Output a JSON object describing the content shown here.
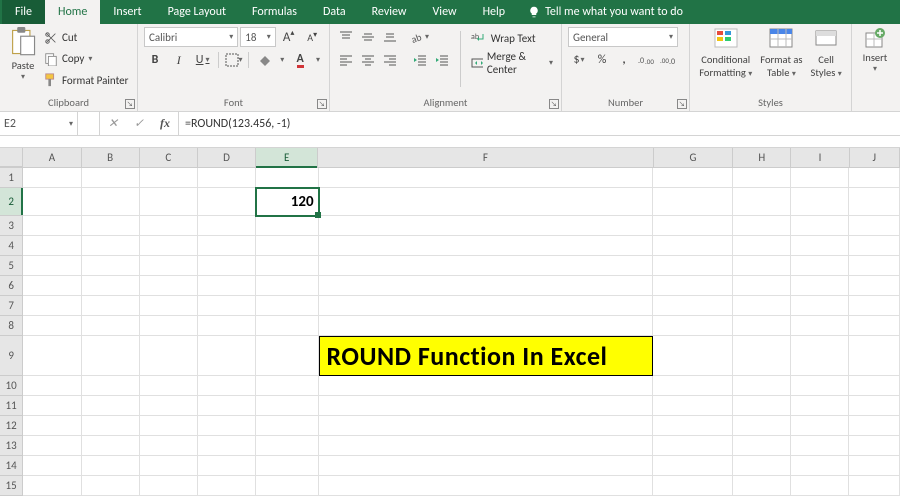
{
  "tabs": {
    "file": "File",
    "home": "Home",
    "insert": "Insert",
    "pageLayout": "Page Layout",
    "formulas": "Formulas",
    "data": "Data",
    "review": "Review",
    "view": "View",
    "help": "Help",
    "tell": "Tell me what you want to do"
  },
  "clipboard": {
    "paste": "Paste",
    "cut": "Cut",
    "copy": "Copy",
    "fmtPainter": "Format Painter",
    "label": "Clipboard"
  },
  "font": {
    "name": "Calibri",
    "size": "18",
    "incA": "A",
    "decA": "A",
    "bold": "B",
    "italic": "I",
    "underline": "U",
    "label": "Font"
  },
  "alignment": {
    "wrap": "Wrap Text",
    "merge": "Merge & Center",
    "label": "Alignment"
  },
  "number": {
    "format": "General",
    "dollar": "$",
    "percent": "%",
    "comma": ",",
    "label": "Number"
  },
  "styles": {
    "cf": "Conditional",
    "cf2": "Formatting",
    "fat": "Format as",
    "fat2": "Table",
    "cs": "Cell",
    "cs2": "Styles",
    "label": "Styles"
  },
  "cellsGrp": {
    "insert": "Insert"
  },
  "namebox": "E2",
  "formula": "=ROUND(123.456, -1)",
  "activeValue": "120",
  "banner": "ROUND Function In Excel",
  "cols": [
    "A",
    "B",
    "C",
    "D",
    "E",
    "F",
    "G",
    "H",
    "I",
    "J"
  ],
  "rowCount": 15,
  "activeCell": {
    "row": 2,
    "col": "E"
  },
  "bannerCell": {
    "row": 9,
    "col": "F"
  }
}
